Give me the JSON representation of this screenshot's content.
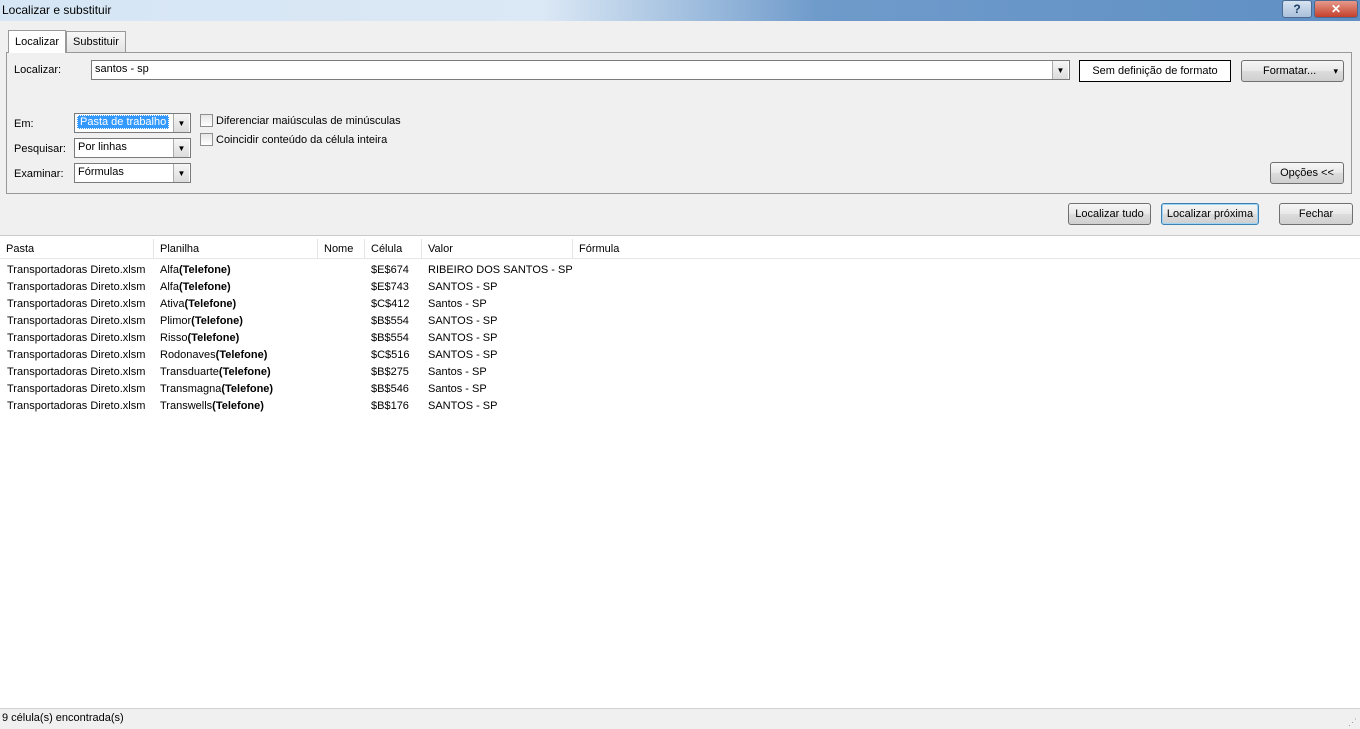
{
  "window": {
    "title": "Localizar e substituir",
    "help_label": "?",
    "close_label": "✕"
  },
  "tabs": [
    {
      "label": "Localizar",
      "active": true
    },
    {
      "label": "Substituir",
      "active": false
    }
  ],
  "find": {
    "label": "Localizar:",
    "value": "santos - sp",
    "format_preview": "Sem definição de formato",
    "format_button": "Formatar...",
    "format_arrow": "▾"
  },
  "options": {
    "within_label": "Em:",
    "within_value": "Pasta de trabalho",
    "search_label": "Pesquisar:",
    "search_value": "Por linhas",
    "look_in_label": "Examinar:",
    "look_in_value": "Fórmulas",
    "match_case_label": "Diferenciar maiúsculas de minúsculas",
    "match_entire_label": "Coincidir conteúdo da célula inteira",
    "options_button": "Opções <<"
  },
  "actions": {
    "find_all": "Localizar tudo",
    "find_next": "Localizar próxima",
    "close": "Fechar"
  },
  "results": {
    "columns": [
      "Pasta",
      "Planilha",
      "Nome",
      "Célula",
      "Valor",
      "Fórmula"
    ],
    "rows": [
      {
        "pasta": "Transportadoras Direto.xlsm",
        "planilha": "Alfa",
        "suffix": "(Telefone)",
        "celula": "$E$674",
        "valor": "RIBEIRO DOS SANTOS - SP"
      },
      {
        "pasta": "Transportadoras Direto.xlsm",
        "planilha": "Alfa",
        "suffix": "(Telefone)",
        "celula": "$E$743",
        "valor": "SANTOS - SP"
      },
      {
        "pasta": "Transportadoras Direto.xlsm",
        "planilha": "Ativa",
        "suffix": "(Telefone)",
        "celula": "$C$412",
        "valor": "Santos - SP"
      },
      {
        "pasta": "Transportadoras Direto.xlsm",
        "planilha": "Plimor",
        "suffix": "(Telefone)",
        "celula": "$B$554",
        "valor": "SANTOS - SP"
      },
      {
        "pasta": "Transportadoras Direto.xlsm",
        "planilha": "Risso",
        "suffix": "(Telefone)",
        "celula": "$B$554",
        "valor": "SANTOS - SP"
      },
      {
        "pasta": "Transportadoras Direto.xlsm",
        "planilha": "Rodonaves",
        "suffix": "(Telefone)",
        "celula": "$C$516",
        "valor": "SANTOS - SP"
      },
      {
        "pasta": "Transportadoras Direto.xlsm",
        "planilha": "Transduarte ",
        "suffix": "(Telefone)",
        "celula": "$B$275",
        "valor": "Santos - SP"
      },
      {
        "pasta": "Transportadoras Direto.xlsm",
        "planilha": "Transmagna ",
        "suffix": "(Telefone)",
        "celula": "$B$546",
        "valor": "Santos - SP"
      },
      {
        "pasta": "Transportadoras Direto.xlsm",
        "planilha": "Transwells ",
        "suffix": "(Telefone)",
        "celula": "$B$176",
        "valor": "SANTOS - SP"
      }
    ]
  },
  "status": {
    "text": "9 célula(s) encontrada(s)"
  }
}
